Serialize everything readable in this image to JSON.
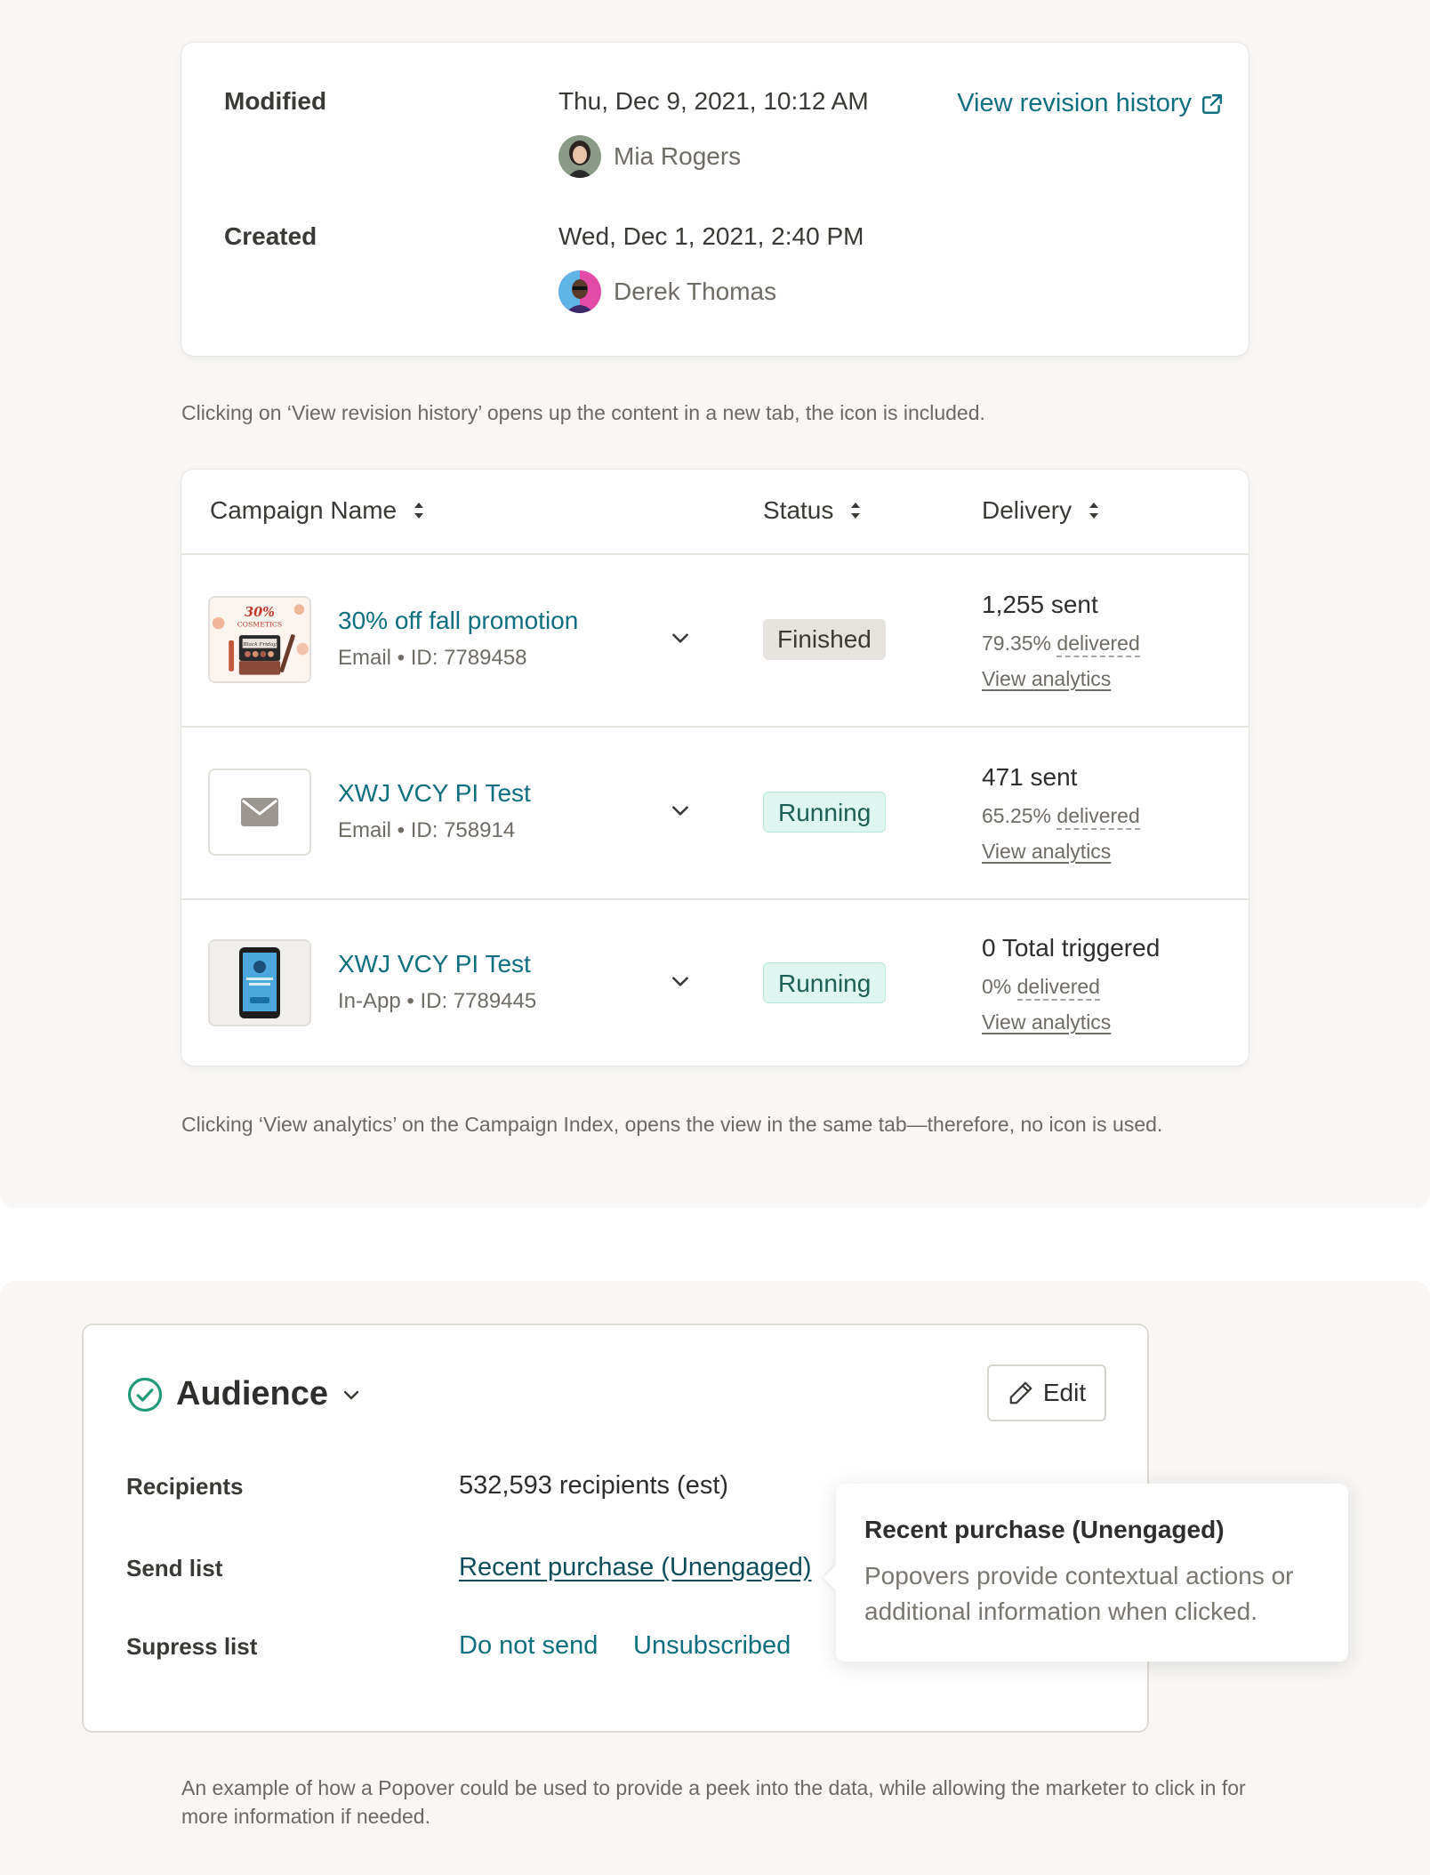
{
  "meta_card": {
    "modified_label": "Modified",
    "modified_date": "Thu, Dec 9, 2021, 10:12 AM",
    "modified_by": "Mia Rogers",
    "created_label": "Created",
    "created_date": "Wed, Dec 1, 2021, 2:40 PM",
    "created_by": "Derek Thomas",
    "revision_link": "View revision history",
    "revision_icon": "external-link-icon"
  },
  "caption_revision": "Clicking on ‘View revision history’ opens up the content in a new tab, the icon is included.",
  "table": {
    "columns": [
      "Campaign Name",
      "Status",
      "Delivery"
    ],
    "rows": [
      {
        "name": "30% off fall promotion",
        "meta": "Email • ID: 7789458",
        "status": "Finished",
        "count": "1,255 sent",
        "pct": "79.35%",
        "pct_label": "delivered",
        "analytics": "View analytics",
        "thumb": "cosmetics-thumbnail",
        "thumb_text_top": "30%",
        "thumb_text_sub": "COSMETICS",
        "thumb_text_tag": "Black Friday"
      },
      {
        "name": "XWJ VCY PI Test",
        "meta": "Email • ID: 758914",
        "status": "Running",
        "count": "471 sent",
        "pct": "65.25%",
        "pct_label": "delivered",
        "analytics": "View analytics",
        "thumb": "envelope-icon"
      },
      {
        "name": "XWJ VCY PI Test",
        "meta": "In-App • ID: 7789445",
        "status": "Running",
        "count": "0 Total triggered",
        "pct": "0%",
        "pct_label": "delivered",
        "analytics": "View analytics",
        "thumb": "phone-thumbnail"
      }
    ]
  },
  "caption_analytics": "Clicking ‘View analytics’ on the Campaign Index, opens the view in the same tab—therefore, no icon is used.",
  "audience": {
    "title": "Audience",
    "edit_label": "Edit",
    "recipients_label": "Recipients",
    "recipients_value": "532,593 recipients (est)",
    "send_list_label": "Send list",
    "send_list_value": "Recent purchase (Unengaged)",
    "supress_label": "Supress list",
    "supress_items": [
      "Do not send",
      "Unsubscribed"
    ]
  },
  "popover": {
    "title": "Recent purchase (Unengaged)",
    "body": "Popovers provide contextual actions or additional information when clicked."
  },
  "caption_popover": "An example of how a Popover could be used to provide a peek into the data, while allowing the marketer to click in for more information if needed.",
  "colors": {
    "link": "#0d6f80",
    "running_bg": "#dff5ef",
    "finished_bg": "#e6e3df",
    "check_green": "#1f9a7b",
    "section_bg": "#f8f7f5"
  }
}
